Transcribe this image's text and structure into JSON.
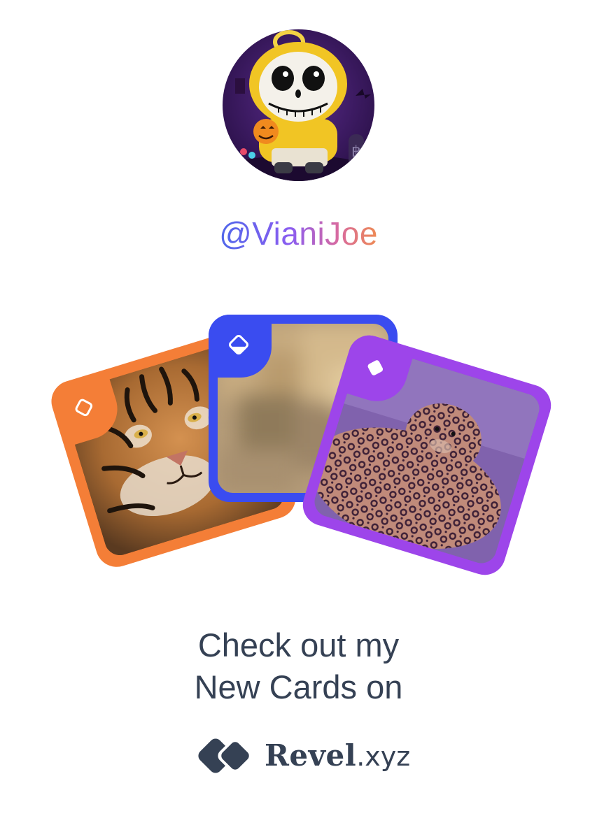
{
  "profile": {
    "avatar_icon": "skeleton-mascot-avatar",
    "username": "@VianiJoe"
  },
  "cards": [
    {
      "name": "tiger-card",
      "frame_color": "#f47e37",
      "badge_icon": "diamond-outline-icon",
      "image": "tiger-photo"
    },
    {
      "name": "blurred-card",
      "frame_color": "#3a4cf0",
      "badge_icon": "diamond-half-icon",
      "image": "blurred-photo"
    },
    {
      "name": "leopard-card",
      "frame_color": "#9d45ea",
      "badge_icon": "diamond-solid-icon",
      "image": "leopards-photo"
    }
  ],
  "headline": {
    "line1": "Check out my",
    "line2": "New Cards on"
  },
  "brand": {
    "logo_icon": "revel-logo-icon",
    "name": "Revel",
    "tld": ".xyz"
  },
  "colors": {
    "text": "#354154",
    "gradient_start": "#4f67ea",
    "gradient_end": "#ee8a52"
  }
}
